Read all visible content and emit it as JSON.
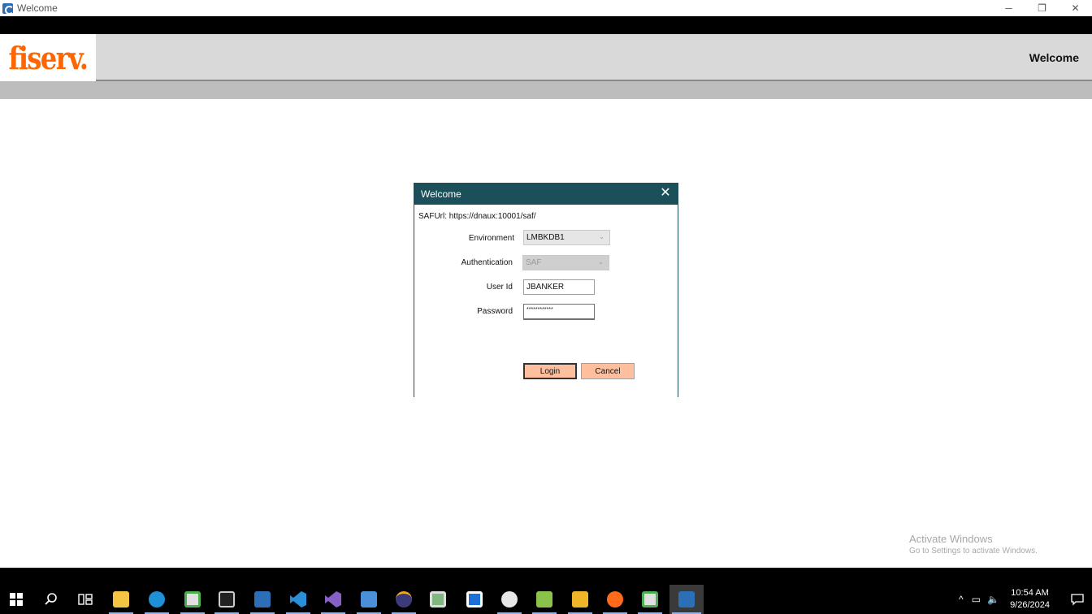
{
  "window": {
    "title": "Welcome",
    "minimize": "─",
    "restore": "❐",
    "close": "✕"
  },
  "header": {
    "logo": "fiserv.",
    "title": "Welcome"
  },
  "dialog": {
    "title": "Welcome",
    "close": "✕",
    "saf_url": "SAFUrl: https://dnaux:10001/saf/",
    "environment_label": "Environment",
    "environment_value": "LMBKDB1",
    "authentication_label": "Authentication",
    "authentication_value": "SAF",
    "user_id_label": "User Id",
    "user_id_value": "JBANKER",
    "password_label": "Password",
    "password_value": "************",
    "login_label": "Login",
    "cancel_label": "Cancel"
  },
  "watermark": {
    "line1": "Activate Windows",
    "line2": "Go to Settings to activate Windows."
  },
  "taskbar": {
    "apps": [
      {
        "name": "start",
        "color": "#ffffff"
      },
      {
        "name": "search",
        "color": "#ffffff"
      },
      {
        "name": "task-view",
        "color": "#ffffff"
      },
      {
        "name": "file-explorer",
        "color": "#f4c542"
      },
      {
        "name": "edge",
        "color": "#1e90d8"
      },
      {
        "name": "app-player",
        "color": "#4caf50"
      },
      {
        "name": "terminal",
        "color": "#cccccc"
      },
      {
        "name": "fiserv-app",
        "color": "#2d6fb7"
      },
      {
        "name": "vscode",
        "color": "#2a8fd8"
      },
      {
        "name": "visual-studio",
        "color": "#8661c5"
      },
      {
        "name": "tool-app",
        "color": "#4a8fd8"
      },
      {
        "name": "eclipse",
        "color": "#3b3b7a"
      },
      {
        "name": "app-green",
        "color": "#7fb77e"
      },
      {
        "name": "app-blue",
        "color": "#1e6fd8"
      },
      {
        "name": "paint-app",
        "color": "#e8e8e8"
      },
      {
        "name": "notepad-green",
        "color": "#8bc34a"
      },
      {
        "name": "installer",
        "color": "#f0b429"
      },
      {
        "name": "orange-app",
        "color": "#ff6b1a"
      },
      {
        "name": "app-player-2",
        "color": "#4caf50"
      },
      {
        "name": "fiserv-app-active",
        "color": "#2d6fb7"
      }
    ],
    "time": "10:54 AM",
    "date": "9/26/2024"
  }
}
